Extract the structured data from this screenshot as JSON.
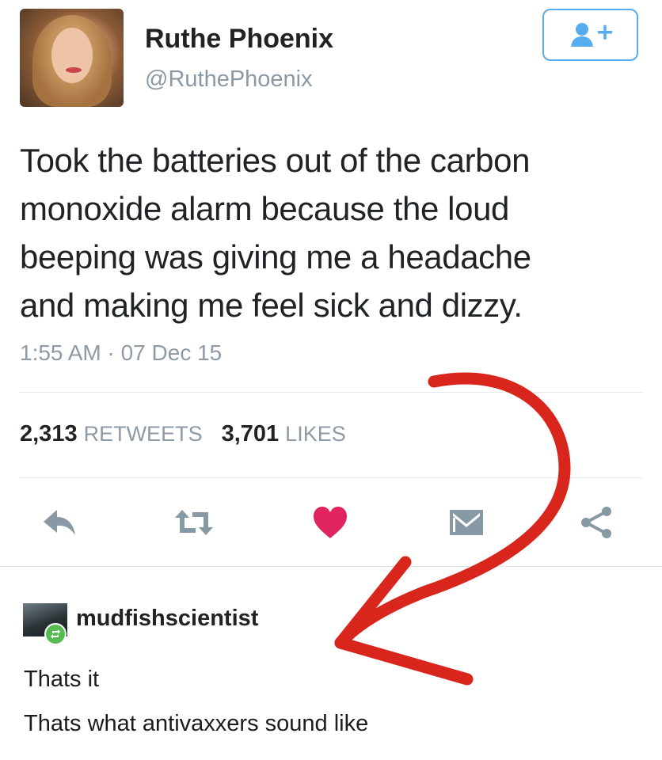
{
  "tweet": {
    "author_name": "Ruthe Phoenix",
    "author_handle": "@RuthePhoenix",
    "text": "Took the batteries out of the carbon\nmonoxide alarm because the loud\nbeeping was giving me a headache\nand making me feel sick and dizzy.",
    "timestamp": "1:55 AM · 07 Dec 15",
    "retweet_count": "2,313",
    "retweet_label": "RETWEETS",
    "like_count": "3,701",
    "like_label": "LIKES"
  },
  "actions": {
    "reply_icon": "reply-icon",
    "retweet_icon": "retweet-icon",
    "like_icon": "heart-icon",
    "dm_icon": "envelope-icon",
    "share_icon": "share-icon"
  },
  "colors": {
    "twitter_blue": "#55acee",
    "muted_text": "#8e9aa5",
    "icon_gray": "#8899a6",
    "heart_red": "#e0245e",
    "annotation_red": "#d9261c",
    "reblog_green": "#56bc52"
  },
  "tumblr": {
    "username": "mudfishscientist",
    "reply_lines": [
      "Thats it",
      "Thats what antivaxxers sound like"
    ]
  }
}
